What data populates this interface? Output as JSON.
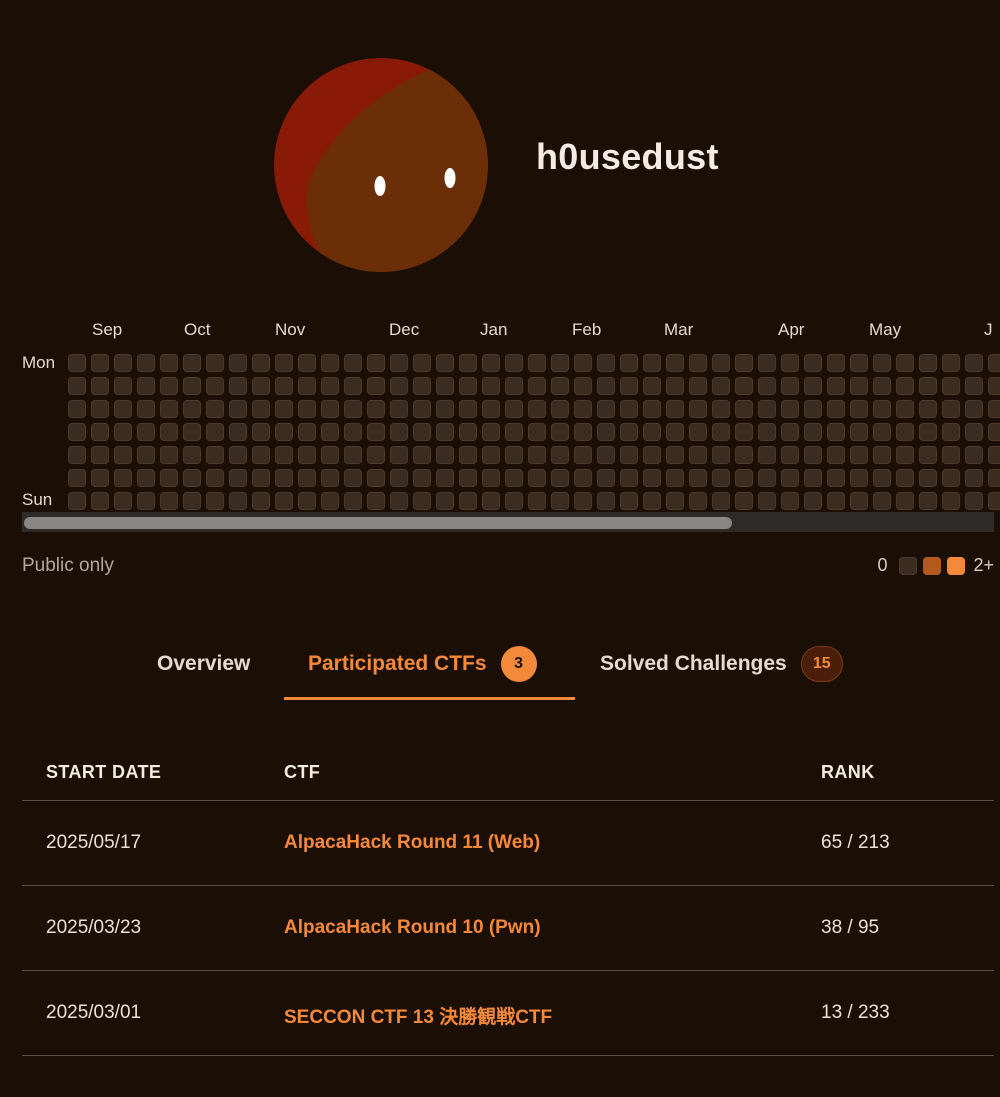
{
  "profile": {
    "username": "h0usedust"
  },
  "heatmap": {
    "months": [
      "Sep",
      "Oct",
      "Nov",
      "Dec",
      "Jan",
      "Feb",
      "Mar",
      "Apr",
      "May",
      "J"
    ],
    "day_labels": [
      "Mon",
      "Sun"
    ],
    "visibility_label": "Public only",
    "legend": {
      "min_label": "0",
      "max_label": "2+",
      "colors": [
        "#3a2c21",
        "#b45a1e",
        "#f5893a"
      ]
    },
    "empty_color": "#3a2c21",
    "scroll_position": 0.73
  },
  "tabs": [
    {
      "label": "Overview",
      "active": false
    },
    {
      "label": "Participated CTFs",
      "count": "3",
      "active": true
    },
    {
      "label": "Solved Challenges",
      "count": "15",
      "active": false
    }
  ],
  "table": {
    "headers": {
      "start_date": "START DATE",
      "ctf": "CTF",
      "rank": "RANK"
    },
    "rows": [
      {
        "start_date": "2025/05/17",
        "ctf": "AlpacaHack Round 11 (Web)",
        "rank": "65 / 213"
      },
      {
        "start_date": "2025/03/23",
        "ctf": "AlpacaHack Round 10 (Pwn)",
        "rank": "38 / 95"
      },
      {
        "start_date": "2025/03/01",
        "ctf": "SECCON CTF 13 決勝観戦CTF",
        "rank": "13 / 233"
      }
    ]
  },
  "colors": {
    "background": "#1b0e04",
    "accent": "#f5893a",
    "avatar_face": "#6b2e06",
    "avatar_back": "#8a1a08"
  }
}
